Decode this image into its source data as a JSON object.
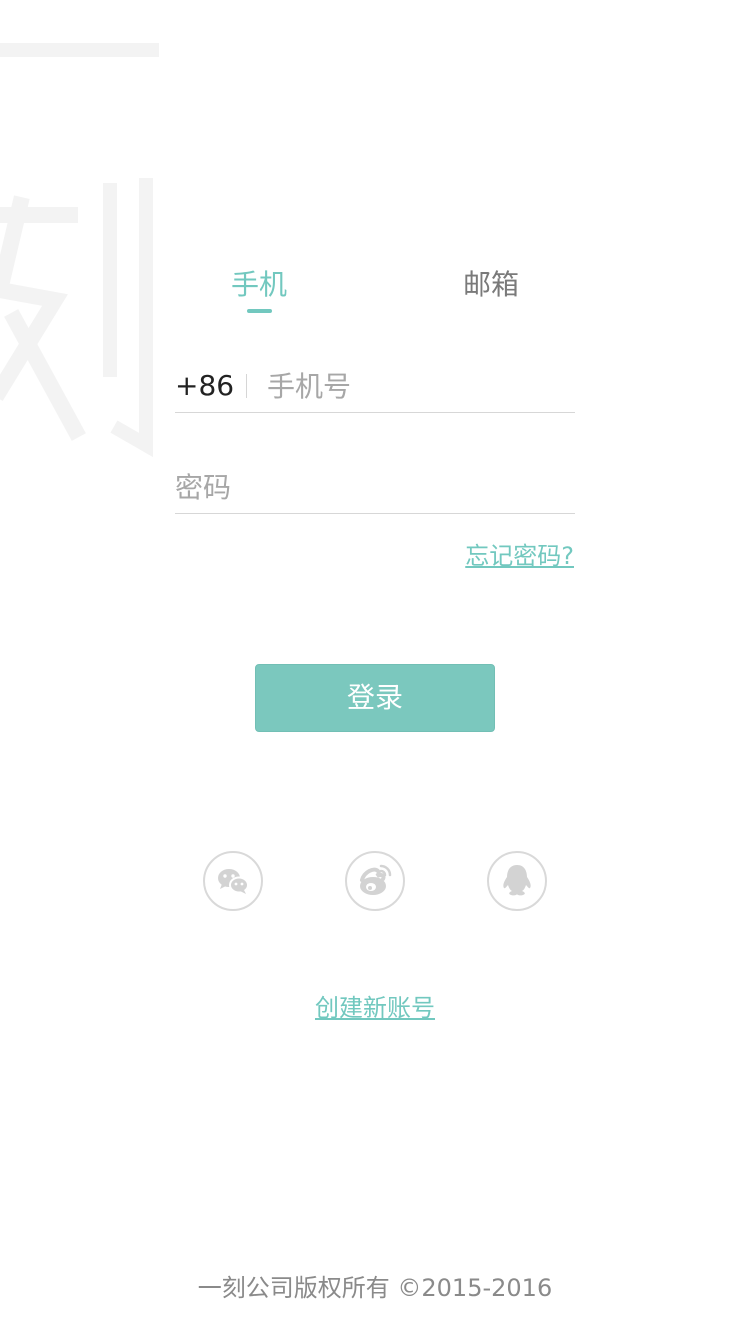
{
  "tabs": {
    "phone": "手机",
    "email": "邮箱"
  },
  "phone_field": {
    "country_code": "+86",
    "placeholder": "手机号",
    "value": ""
  },
  "password_field": {
    "placeholder": "密码",
    "value": ""
  },
  "forgot_password": "忘记密码?",
  "login_button": "登录",
  "social": [
    {
      "icon": "wechat-icon"
    },
    {
      "icon": "weibo-icon"
    },
    {
      "icon": "qq-icon"
    }
  ],
  "create_account": "创建新账号",
  "footer": "一刻公司版权所有 ©2015-2016",
  "colors": {
    "accent": "#72c8bf",
    "button": "#7bc8be",
    "muted": "#8a8a8a",
    "line": "#d7d7d7"
  }
}
